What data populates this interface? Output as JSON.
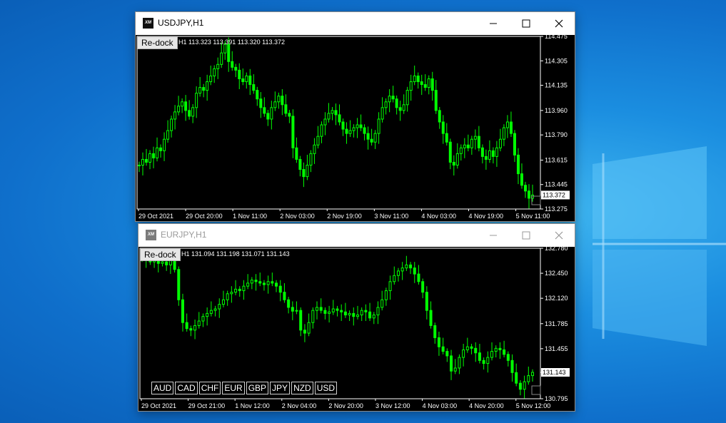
{
  "windows": [
    {
      "title": "USDJPY,H1",
      "redock_label": "Re-dock",
      "ohlc_text": "H1  113.323 113.391 113.320 113.372",
      "current_price": "113.372",
      "current_value": 113.372,
      "price_axis": [
        "114.475",
        "114.305",
        "114.135",
        "113.960",
        "113.790",
        "113.615",
        "113.445",
        "113.275"
      ],
      "time_axis": [
        "29 Oct 2021",
        "29 Oct 20:00",
        "1 Nov 11:00",
        "2 Nov 03:00",
        "2 Nov 19:00",
        "3 Nov 11:00",
        "4 Nov 03:00",
        "4 Nov 19:00",
        "5 Nov 11:00"
      ],
      "ylim": [
        113.275,
        114.475
      ],
      "series_color": "#00ff00",
      "series": [
        113.58,
        113.62,
        113.6,
        113.66,
        113.63,
        113.7,
        113.68,
        113.76,
        113.82,
        113.9,
        113.95,
        113.99,
        114.02,
        113.96,
        113.92,
        113.98,
        114.08,
        114.12,
        114.1,
        114.16,
        114.2,
        114.25,
        114.28,
        114.36,
        114.42,
        114.3,
        114.26,
        114.24,
        114.18,
        114.16,
        114.2,
        114.14,
        114.1,
        114.04,
        113.98,
        113.94,
        113.9,
        113.98,
        114.02,
        114.06,
        114.0,
        113.94,
        113.92,
        113.7,
        113.62,
        113.55,
        113.5,
        113.58,
        113.66,
        113.72,
        113.78,
        113.86,
        113.9,
        113.94,
        113.96,
        113.93,
        113.88,
        113.83,
        113.8,
        113.82,
        113.84,
        113.86,
        113.84,
        113.8,
        113.76,
        113.74,
        113.8,
        113.9,
        113.98,
        114.02,
        114.06,
        114.04,
        113.98,
        113.96,
        114.0,
        114.1,
        114.16,
        114.2,
        114.16,
        114.14,
        114.12,
        114.18,
        114.1,
        113.96,
        113.88,
        113.8,
        113.74,
        113.6,
        113.58,
        113.66,
        113.7,
        113.72,
        113.7,
        113.76,
        113.78,
        113.7,
        113.64,
        113.62,
        113.68,
        113.64,
        113.7,
        113.76,
        113.84,
        113.88,
        113.8,
        113.65,
        113.52,
        113.44,
        113.4,
        113.35,
        113.372
      ],
      "currency_buttons": []
    },
    {
      "title": "EURJPY,H1",
      "redock_label": "Re-dock",
      "ohlc_text": "H1  131.094 131.198 131.071 131.143",
      "current_price": "131.143",
      "current_value": 131.143,
      "price_axis": [
        "132.780",
        "132.450",
        "132.120",
        "131.785",
        "131.455",
        "131.143",
        "130.795"
      ],
      "time_axis": [
        "29 Oct 2021",
        "29 Oct 21:00",
        "1 Nov 12:00",
        "2 Nov 04:00",
        "2 Nov 20:00",
        "3 Nov 12:00",
        "4 Nov 03:00",
        "4 Nov 20:00",
        "5 Nov 12:00"
      ],
      "ylim": [
        130.795,
        132.78
      ],
      "series_color": "#00ff00",
      "series": [
        132.68,
        132.64,
        132.6,
        132.62,
        132.58,
        132.6,
        132.56,
        132.62,
        132.5,
        132.1,
        131.8,
        131.72,
        131.7,
        131.76,
        131.82,
        131.88,
        131.92,
        131.96,
        131.98,
        132.04,
        132.1,
        132.18,
        132.2,
        132.24,
        132.22,
        132.28,
        132.32,
        132.36,
        132.34,
        132.32,
        132.3,
        132.34,
        132.32,
        132.28,
        132.2,
        132.1,
        132.0,
        131.95,
        131.96,
        131.7,
        131.66,
        131.8,
        131.96,
        132.0,
        131.96,
        131.92,
        131.94,
        131.98,
        131.96,
        131.94,
        131.9,
        131.92,
        131.88,
        131.9,
        131.96,
        131.94,
        131.86,
        131.9,
        132.0,
        132.1,
        132.22,
        132.34,
        132.42,
        132.48,
        132.52,
        132.56,
        132.52,
        132.44,
        132.34,
        132.2,
        131.96,
        131.76,
        131.6,
        131.48,
        131.42,
        131.36,
        131.16,
        131.2,
        131.34,
        131.44,
        131.48,
        131.46,
        131.4,
        131.3,
        131.26,
        131.34,
        131.42,
        131.46,
        131.44,
        131.38,
        131.3,
        131.14,
        131.0,
        130.92,
        131.02,
        131.1,
        131.143
      ],
      "currency_buttons": [
        "AUD",
        "CAD",
        "CHF",
        "EUR",
        "GBP",
        "JPY",
        "NZD",
        "USD"
      ]
    }
  ]
}
